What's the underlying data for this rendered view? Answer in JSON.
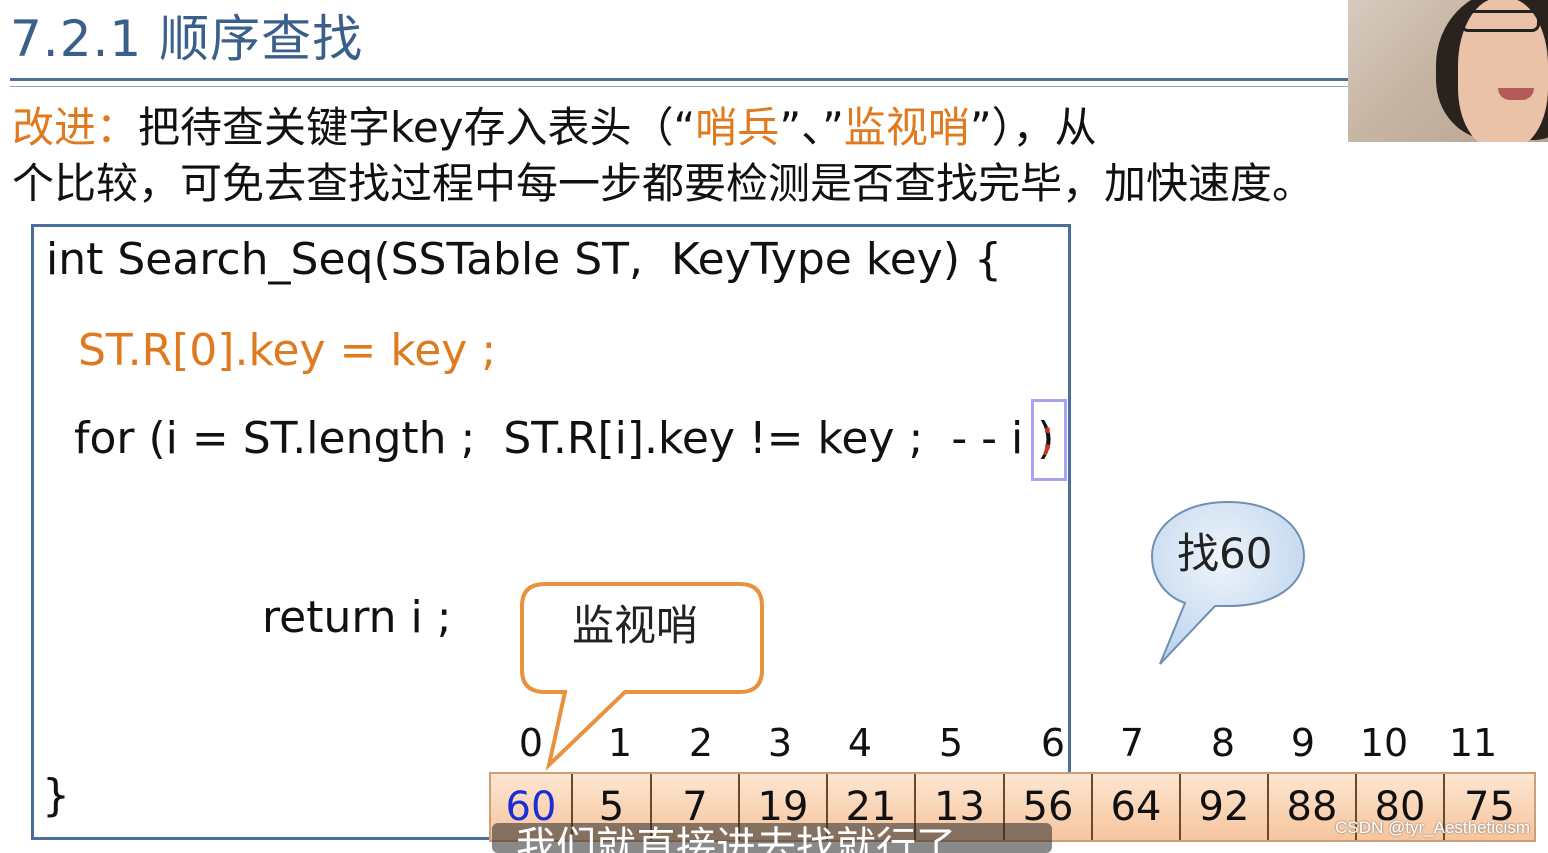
{
  "title": "7.2.1 顺序查找",
  "intro": {
    "lead": "改进：",
    "part1": "把待查关键字key存入表头（“",
    "sentinel": "哨兵",
    "mid": "”、”",
    "watch": "监视哨",
    "part2": "”），从",
    "line2": "个比较，可免去查找过程中每一步都要检测是否查找完毕，加快速度。"
  },
  "code": {
    "line1": "int Search_Seq(SSTable ST,  KeyType key) {",
    "line2": "ST.R[0].key = key ;",
    "line3": "for (i = ST.length ;  ST.R[i].key != key ;  - - i )",
    "semicolon": ";",
    "line4": "return i ;",
    "close": "}"
  },
  "callouts": {
    "sentinel_label": "监视哨",
    "search_label": "找60"
  },
  "indices": [
    "0",
    "1",
    "2",
    "3",
    "4",
    "5",
    "6",
    "7",
    "8",
    "9",
    "10",
    "11"
  ],
  "array": [
    "60",
    "5",
    "7",
    "19",
    "21",
    "13",
    "56",
    "64",
    "92",
    "88",
    "80",
    "75"
  ],
  "subtitle": "我们就直接进去找就行了",
  "watermark": "CSDN @tyr_Aestheticism",
  "colors": {
    "title": "#3a5f8a",
    "accent": "#e07a1e",
    "sentinel_value": "#1a2ed8",
    "callout_orange": "#e8923d",
    "callout_blue": "#cfe0f3"
  }
}
